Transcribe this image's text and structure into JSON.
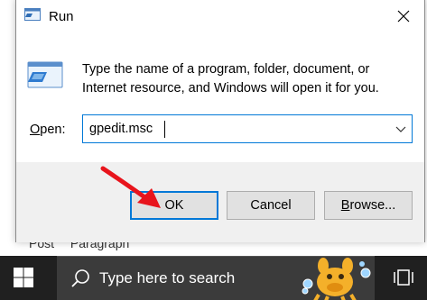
{
  "background": {
    "tabs": [
      "Post",
      "Paragraph"
    ]
  },
  "dialog": {
    "title": "Run",
    "description": "Type the name of a program, folder, document, or Internet resource, and Windows will open it for you.",
    "open_label_prefix": "O",
    "open_label_rest": "pen:",
    "open_value": "gpedit.msc",
    "buttons": {
      "ok": "OK",
      "cancel": "Cancel",
      "browse_prefix": "B",
      "browse_rest": "rowse..."
    }
  },
  "taskbar": {
    "search_placeholder": "Type here to search"
  },
  "colors": {
    "accent": "#0078d7",
    "arrow": "#e8141c",
    "taskbar": "#202020"
  }
}
